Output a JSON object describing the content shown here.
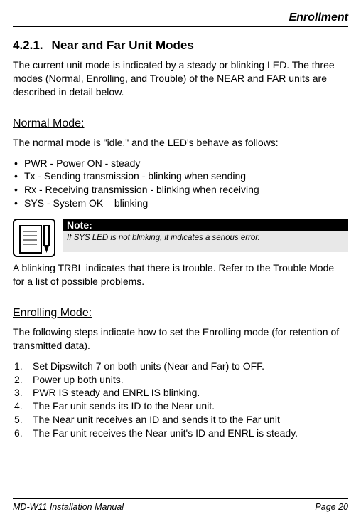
{
  "header": {
    "chapter": "Enrollment"
  },
  "section": {
    "number": "4.2.1.",
    "title": "Near and Far Unit Modes",
    "intro": "The current unit mode is indicated by a steady or blinking LED. The three modes (Normal, Enrolling, and Trouble) of the NEAR and FAR units are described in detail below."
  },
  "normal": {
    "heading": "Normal Mode:",
    "desc": "The normal mode is \"idle,\" and the LED's behave as follows:",
    "bullets": [
      "PWR - Power ON - steady",
      "Tx - Sending transmission - blinking when sending",
      "Rx - Receiving transmission  - blinking when receiving",
      "SYS - System OK – blinking"
    ],
    "note_label": "Note:",
    "note_body": "If SYS LED is not blinking, it indicates a serious error.",
    "trbl": "A blinking TRBL indicates that there is trouble. Refer to the Trouble Mode for a list of possible problems."
  },
  "enrolling": {
    "heading": "Enrolling Mode:",
    "desc": "The following steps indicate how to set the Enrolling mode (for retention of transmitted data).",
    "steps": [
      "Set Dipswitch 7 on both units (Near and Far) to OFF.",
      "Power up both units.",
      "PWR IS steady and ENRL IS blinking.",
      "The Far unit sends its ID to the Near unit.",
      "The Near unit receives an ID and sends it to the Far unit",
      "The Far unit receives the Near unit's ID and ENRL is steady."
    ]
  },
  "footer": {
    "left": "MD-W11 Installation Manual",
    "right": "Page 20"
  }
}
